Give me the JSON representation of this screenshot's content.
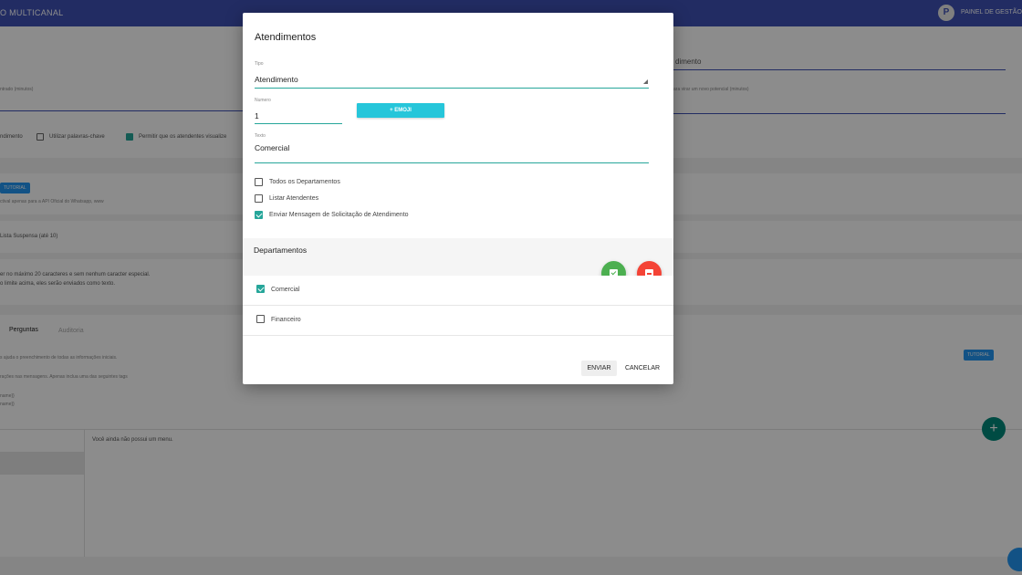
{
  "app": {
    "brand": "O MULTICANAL",
    "avatar_letter": "P",
    "panel_label": "PAINEL DE GESTÃO"
  },
  "background": {
    "field_label_left": "ntrado (minutos)",
    "field_value_right": "dimento",
    "field_label_right": "ara virar um novo potencial (minutos)",
    "checkbox_row_prefix": "ndimento",
    "checkbox_keywords": "Utilizar palavras-chave",
    "checkbox_allow": "Permitir que os atendentes visualize",
    "tutorial_btn": "TUTORIAL",
    "api_note": "ctival apenas para a API Oficial do Whatsapp, www",
    "list_note": "Lista Suspensa (até 10)",
    "chars_note_1": "er no máximo 20 caracteres e sem nenhum caracter especial.",
    "chars_note_2": "o limite acima, eles serão enviados como texto.",
    "tab_perguntas": "Perguntas",
    "tab_auditoria": "Auditoria",
    "help_1": "s ajuda o preenchimento de todas as informações iniciais.",
    "help_2": "rações nas mensagens. Apenas inclua uma das seguintes tags",
    "help_3": "name}}",
    "help_4": "name}}",
    "tutorial_btn_2": "TUTORIAL",
    "empty_menu": "Você ainda não possui um menu."
  },
  "modal": {
    "title": "Atendimentos",
    "tipo": {
      "label": "Tipo",
      "value": "Atendimento"
    },
    "numero": {
      "label": "Numero",
      "value": "1"
    },
    "emoji_button": "+ EMOJI",
    "texto": {
      "label": "Texto",
      "value": "Comercial"
    },
    "options": [
      {
        "label": "Todos os Departamentos",
        "checked": false
      },
      {
        "label": "Listar Atendentes",
        "checked": false
      },
      {
        "label": "Enviar Mensagem de Solicitação de Atendimento",
        "checked": true
      }
    ],
    "departments_title": "Departamentos",
    "departments": [
      {
        "label": "Comercial",
        "checked": true
      },
      {
        "label": "Financeiro",
        "checked": false
      }
    ],
    "send_label": "ENVIAR",
    "cancel_label": "CANCELAR",
    "colors": {
      "accent": "#26a69a",
      "emoji": "#26c6da",
      "green": "#4caf50",
      "red": "#f44336"
    }
  }
}
